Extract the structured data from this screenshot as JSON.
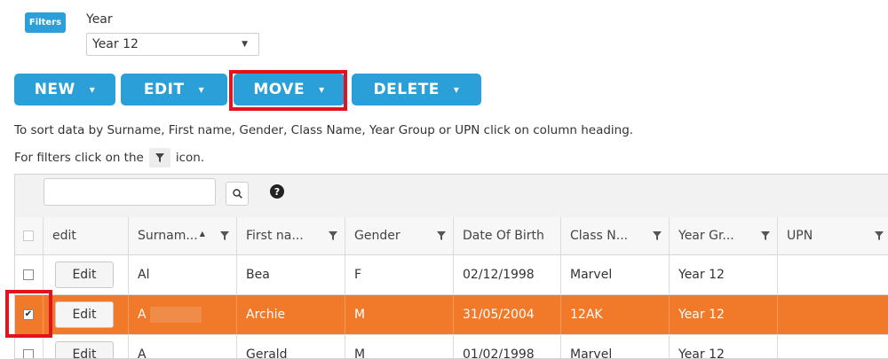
{
  "filters": {
    "badge": "Filters",
    "year_label": "Year",
    "year_value": "Year 12"
  },
  "toolbar": {
    "new": "NEW",
    "edit": "EDIT",
    "move": "MOVE",
    "delete": "DELETE",
    "dropdown_glyph": "▾"
  },
  "info": {
    "sort_text": "To sort data by Surname, First name, Gender, Class Name, Year Group or UPN click on column heading.",
    "filter_prefix": "For filters click on the",
    "filter_suffix": "icon."
  },
  "grid": {
    "search_value": "",
    "help_glyph": "?",
    "headers": [
      "edit",
      "Surnam...",
      "First na...",
      "Gender",
      "Date Of Birth",
      "Class N...",
      "Year Gr...",
      "UPN"
    ],
    "sort_indicator": "▲",
    "edit_label": "Edit",
    "rows": [
      {
        "checked": false,
        "surname": "Al",
        "first": "Bea",
        "gender": "F",
        "dob": "02/12/1998",
        "class": "Marvel",
        "year": "Year 12",
        "upn": ""
      },
      {
        "checked": true,
        "surname": "A",
        "first": "Archie",
        "gender": "M",
        "dob": "31/05/2004",
        "class": "12AK",
        "year": "Year 12",
        "upn": ""
      },
      {
        "checked": false,
        "surname": "A",
        "first": "Gerald",
        "gender": "M",
        "dob": "01/02/1998",
        "class": "Marvel",
        "year": "Year 12",
        "upn": ""
      }
    ]
  },
  "colors": {
    "accent": "#2a9fd8",
    "selected_row": "#f07a2a",
    "highlight": "#e0141c"
  }
}
